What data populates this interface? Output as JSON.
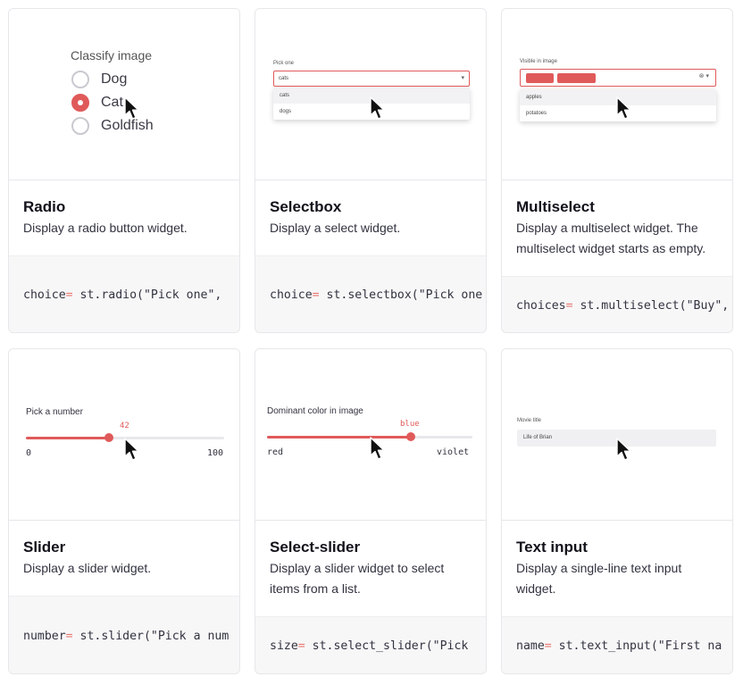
{
  "cards": [
    {
      "title": "Radio",
      "description": "Display a radio button widget.",
      "code_var": "choice",
      "code_op": "=",
      "code_call": " st.radio(\"Pick one\", ",
      "preview": {
        "label": "Classify image",
        "options": [
          "Dog",
          "Cat",
          "Goldfish"
        ],
        "selected_index": 1
      }
    },
    {
      "title": "Selectbox",
      "description": "Display a select widget.",
      "code_var": "choice",
      "code_op": "=",
      "code_call": " st.selectbox(\"Pick one",
      "preview": {
        "label": "Pick one",
        "value": "cats",
        "options": [
          "cats",
          "dogs"
        ]
      }
    },
    {
      "title": "Multiselect",
      "description": "Display a multiselect widget. The multiselect widget starts as empty.",
      "code_var": "choices",
      "code_op": "=",
      "code_call": " st.multiselect(\"Buy\",",
      "preview": {
        "label": "Visible in image",
        "options": [
          "apples",
          "potatoes"
        ]
      }
    },
    {
      "title": "Slider",
      "description": "Display a slider widget.",
      "code_var": "number",
      "code_op": "=",
      "code_call": " st.slider(\"Pick a num",
      "preview": {
        "label": "Pick a number",
        "value": "42",
        "min": "0",
        "max": "100",
        "fraction": 0.42
      }
    },
    {
      "title": "Select-slider",
      "description": "Display a slider widget to select items from a list.",
      "code_var": "size",
      "code_op": "=",
      "code_call": " st.select_slider(\"Pick",
      "preview": {
        "label": "Dominant color in image",
        "value": "blue",
        "min": "red",
        "max": "violet",
        "fraction": 0.7
      }
    },
    {
      "title": "Text input",
      "description": "Display a single-line text input widget.",
      "code_var": "name",
      "code_op": "=",
      "code_call": " st.text_input(\"First na",
      "preview": {
        "label": "Movie title",
        "value": "Life of Brian"
      }
    }
  ],
  "colors": {
    "accent": "#e05a5a",
    "code_bg": "#f7f7f8",
    "border": "#e6e7ea"
  }
}
